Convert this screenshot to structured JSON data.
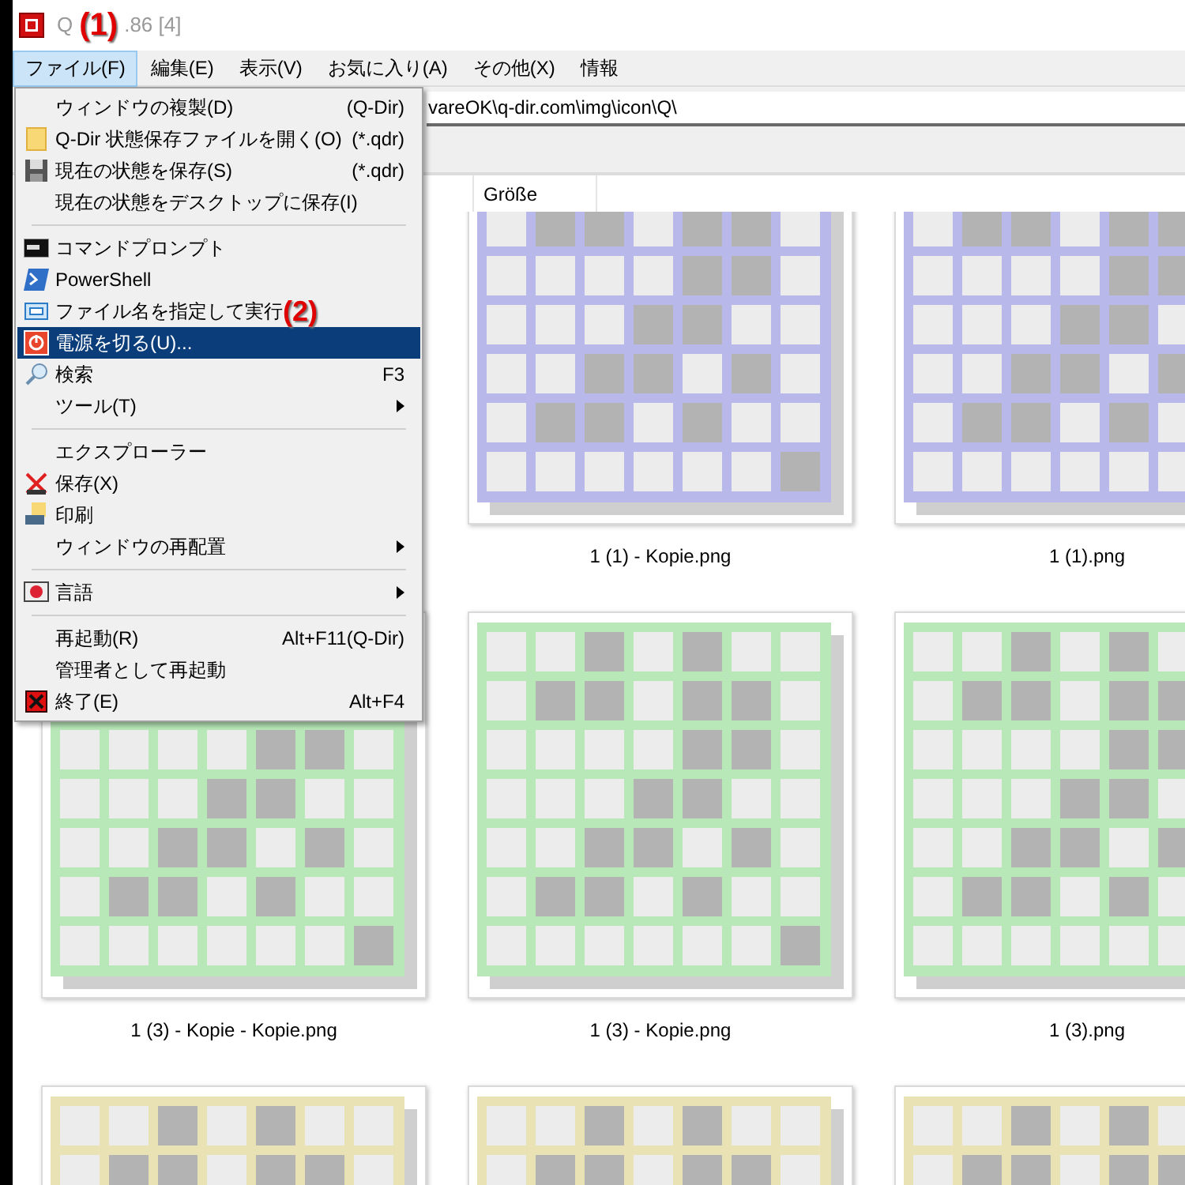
{
  "window": {
    "title_start": "Q",
    "title_end": ".86 [4]",
    "annotation": "(1)"
  },
  "menu_bar": [
    {
      "label": "ファイル(F)",
      "selected": true
    },
    {
      "label": "編集(E)",
      "selected": false
    },
    {
      "label": "表示(V)",
      "selected": false
    },
    {
      "label": "お気に入り(A)",
      "selected": false
    },
    {
      "label": "その他(X)",
      "selected": false
    },
    {
      "label": "情報",
      "selected": false
    }
  ],
  "address": "vareOK\\q-dir.com\\img\\icon\\Q\\",
  "columns": [
    "Größe"
  ],
  "menu": [
    {
      "kind": "item",
      "label": "ウィンドウの複製(D)",
      "shortcut": "(Q-Dir)",
      "selected": false
    },
    {
      "kind": "item",
      "label": "Q-Dir 状態保存ファイルを開く(O)",
      "shortcut": "(*.qdr)",
      "selected": false
    },
    {
      "kind": "item",
      "label": "現在の状態を保存(S)",
      "shortcut": "(*.qdr)",
      "selected": false
    },
    {
      "kind": "item",
      "label": "現在の状態をデスクトップに保存(I)",
      "selected": false
    },
    {
      "kind": "separator"
    },
    {
      "kind": "item",
      "label": "コマンドプロンプト",
      "selected": false
    },
    {
      "kind": "item",
      "label": "PowerShell",
      "selected": false
    },
    {
      "kind": "item",
      "label": "ファイル名を指定して実行",
      "annotation": "(2)",
      "selected": false
    },
    {
      "kind": "item",
      "label": "電源を切る(U)...",
      "selected": true
    },
    {
      "kind": "item",
      "label": "検索",
      "shortcut": "F3",
      "selected": false
    },
    {
      "kind": "submenu",
      "label": "ツール(T)",
      "selected": false
    },
    {
      "kind": "separator"
    },
    {
      "kind": "item",
      "label": "エクスプローラー",
      "selected": false
    },
    {
      "kind": "item",
      "label": "保存(X)",
      "selected": false
    },
    {
      "kind": "item",
      "label": "印刷",
      "selected": false
    },
    {
      "kind": "submenu",
      "label": "ウィンドウの再配置",
      "selected": false
    },
    {
      "kind": "separator"
    },
    {
      "kind": "submenu",
      "label": "言語",
      "selected": false
    },
    {
      "kind": "separator"
    },
    {
      "kind": "item",
      "label": "再起動(R)",
      "shortcut": "Alt+F11(Q-Dir)",
      "selected": false
    },
    {
      "kind": "item",
      "label": "管理者として再起動",
      "selected": false
    },
    {
      "kind": "item",
      "label": "終了(E)",
      "shortcut": "Alt+F4",
      "selected": false
    }
  ],
  "files": [
    {
      "label": "1 (1) - Kopie.png",
      "color": "#b8b8ea"
    },
    {
      "label": "1 (1).png",
      "color": "#b8b8ea"
    },
    {
      "label": "1 (3) - Kopie - Kopie.png",
      "color": "#b8e8b8"
    },
    {
      "label": "1 (3) - Kopie.png",
      "color": "#b8e8b8"
    },
    {
      "label": "1 (3).png",
      "color": "#b8e8b8"
    },
    {
      "color": "#e8e2b4"
    },
    {
      "color": "#e8e2b4"
    },
    {
      "color": "#e8e2b4"
    }
  ]
}
